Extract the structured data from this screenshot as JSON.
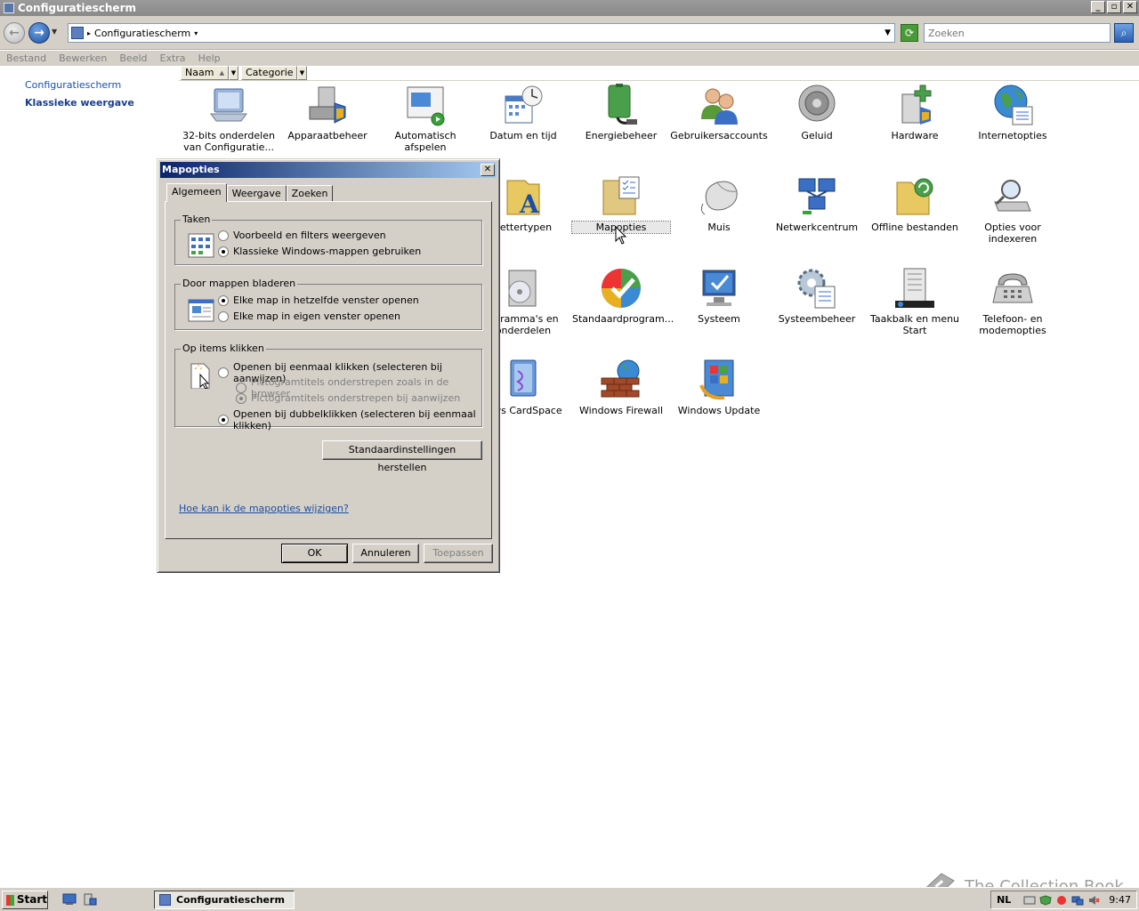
{
  "window": {
    "title": "Configuratiescherm",
    "minimize": "_",
    "maximize": "▫",
    "close": "✕"
  },
  "address": {
    "path": "Configuratiescherm",
    "search_placeholder": "Zoeken"
  },
  "menu": [
    "Bestand",
    "Bewerken",
    "Beeld",
    "Extra",
    "Help"
  ],
  "leftpane": {
    "link_home": "Configuratiescherm",
    "link_classic": "Klassieke weergave"
  },
  "columns": {
    "name": "Naam",
    "category": "Categorie"
  },
  "icons": {
    "row1": [
      {
        "label": "32-bits onderdelen van Configuratie..."
      },
      {
        "label": "Apparaatbeheer"
      },
      {
        "label": "Automatisch afspelen"
      },
      {
        "label": "Datum en tijd"
      },
      {
        "label": "Energiebeheer"
      },
      {
        "label": "Gebruikersaccounts"
      },
      {
        "label": "Geluid"
      },
      {
        "label": "Hardware"
      },
      {
        "label": "Internetopties"
      }
    ],
    "row2": [
      {
        "label": "Lettertypen"
      },
      {
        "label": "Mapopties"
      },
      {
        "label": "Muis"
      },
      {
        "label": "Netwerkcentrum"
      },
      {
        "label": "Offline bestanden"
      },
      {
        "label": "Opties voor indexeren"
      }
    ],
    "row3": [
      {
        "label": "ogramma's en onderdelen"
      },
      {
        "label": "Standaardprogram..."
      },
      {
        "label": "Systeem"
      },
      {
        "label": "Systeembeheer"
      },
      {
        "label": "Taakbalk en menu Start"
      },
      {
        "label": "Telefoon- en modemopties"
      }
    ],
    "row4": [
      {
        "label": "lows CardSpace"
      },
      {
        "label": "Windows Firewall"
      },
      {
        "label": "Windows Update"
      }
    ]
  },
  "dialog": {
    "title": "Mapopties",
    "close": "✕",
    "tabs": [
      "Algemeen",
      "Weergave",
      "Zoeken"
    ],
    "group_tasks": {
      "label": "Taken",
      "opt1": "Voorbeeld en filters weergeven",
      "opt2": "Klassieke Windows-mappen gebruiken"
    },
    "group_browse": {
      "label": "Door mappen bladeren",
      "opt1": "Elke map in hetzelfde venster openen",
      "opt2": "Elke map in eigen venster openen"
    },
    "group_click": {
      "label": "Op items klikken",
      "opt1": "Openen bij eenmaal klikken (selecteren bij aanwijzen)",
      "sub1": "Pictogramtitels onderstrepen zoals in de browser",
      "sub2": "Pictogramtitels onderstrepen bij aanwijzen",
      "opt2": "Openen bij dubbelklikken (selecteren bij eenmaal klikken)"
    },
    "restore_button": "Standaardinstellingen herstellen",
    "help_link": "Hoe kan ik de mapopties wijzigen?",
    "ok": "OK",
    "cancel": "Annuleren",
    "apply": "Toepassen"
  },
  "taskbar": {
    "start": "Start",
    "task": "Configuratiescherm",
    "lang": "NL",
    "clock": "9:47"
  },
  "watermark": "The Collection Book"
}
